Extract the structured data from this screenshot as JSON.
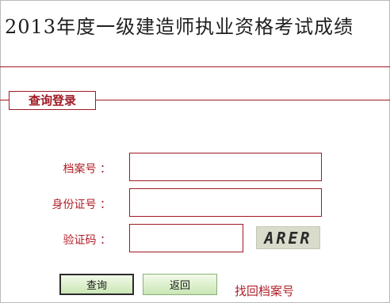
{
  "header": {
    "title": "2013年度一级建造师执业资格考试成绩"
  },
  "login": {
    "legend": "查询登录",
    "fields": [
      {
        "label": "档案号 ：",
        "value": ""
      },
      {
        "label": "身份证号 ：",
        "value": ""
      },
      {
        "label": "验证码 ：",
        "value": ""
      }
    ],
    "captcha_text": "ARER",
    "buttons": {
      "query": "查询",
      "back": "返回"
    },
    "recover_link": "找回档案号"
  },
  "colors": {
    "accent": "#a01a24",
    "label": "#b0202a",
    "button_bg": "#c9e6b4"
  }
}
